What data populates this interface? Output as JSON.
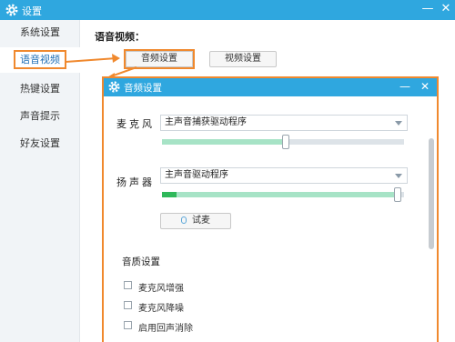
{
  "window": {
    "title": "设置",
    "minimize": "—",
    "close": "✕"
  },
  "sidebar": {
    "items": [
      {
        "label": "系统设置"
      },
      {
        "label": "语音视频"
      },
      {
        "label": "热键设置"
      },
      {
        "label": "声音提示"
      },
      {
        "label": "好友设置"
      }
    ]
  },
  "main": {
    "section_title": "语音视频：",
    "tabs": [
      {
        "label": "音频设置"
      },
      {
        "label": "视频设置"
      }
    ]
  },
  "dialog": {
    "title": "音频设置",
    "minimize": "—",
    "close": "✕",
    "mic_label": "麦克风",
    "mic_device": "主声音捕获驱动程序",
    "mic_level": 0.51,
    "speaker_label": "扬声器",
    "speaker_device": "主声音驱动程序",
    "speaker_level": 0.99,
    "speaker_activity": 0.06,
    "try_button": "试麦",
    "quality_title": "音质设置",
    "options": [
      {
        "label": "麦克风增强"
      },
      {
        "label": "麦克风降噪"
      },
      {
        "label": "启用回声消除"
      }
    ]
  },
  "colors": {
    "titlebar": "#2fa7df",
    "highlight": "#f0892e",
    "slider_fill": "#a7e3c6",
    "level_meter": "#2fb85a"
  }
}
